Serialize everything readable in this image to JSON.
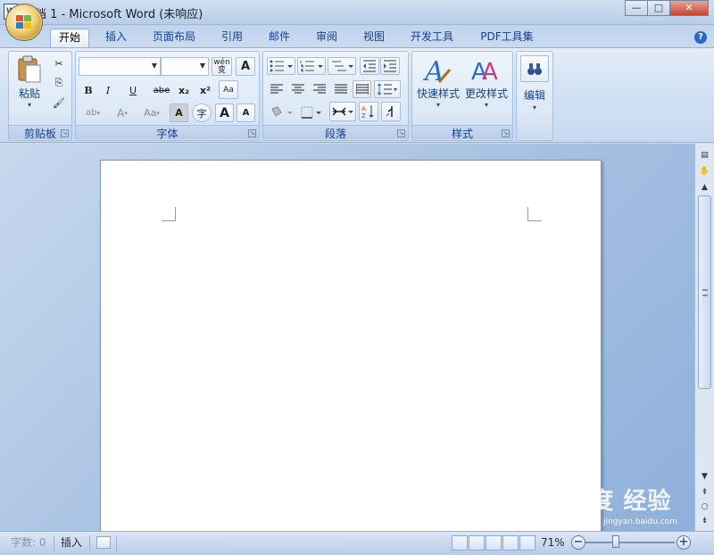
{
  "window": {
    "title": "文档 1 - Microsoft Word (未响应)",
    "app_icon_glyph": "W",
    "minimize_glyph": "—",
    "maximize_glyph": "□",
    "close_glyph": "✕"
  },
  "tabs": [
    {
      "label": "开始",
      "active": true
    },
    {
      "label": "插入",
      "active": false
    },
    {
      "label": "页面布局",
      "active": false
    },
    {
      "label": "引用",
      "active": false
    },
    {
      "label": "邮件",
      "active": false
    },
    {
      "label": "审阅",
      "active": false
    },
    {
      "label": "视图",
      "active": false
    },
    {
      "label": "开发工具",
      "active": false
    },
    {
      "label": "PDF工具集",
      "active": false
    }
  ],
  "help_glyph": "?",
  "ribbon": {
    "clipboard": {
      "label": "剪贴板",
      "paste_label": "粘贴",
      "cut_glyph": "✂",
      "copy_glyph": "⎘",
      "format_painter_glyph": "🖌"
    },
    "font": {
      "label": "字体",
      "font_name": "",
      "font_size": "",
      "wen_glyph": "wén 变",
      "char_border_glyph": "A",
      "bold": "B",
      "italic": "I",
      "underline": "U",
      "strike": "abe",
      "subscript": "x₂",
      "superscript": "x²",
      "clear_format": "Aa",
      "highlight": "ab",
      "font_color": "A",
      "change_case": "Aa",
      "char_shading": "A",
      "enclose": "字",
      "grow": "A",
      "shrink": "A"
    },
    "paragraph": {
      "label": "段落"
    },
    "styles": {
      "label": "样式",
      "quick_styles": "快速样式",
      "change_styles": "更改样式"
    },
    "editing": {
      "label": "编辑"
    }
  },
  "statusbar": {
    "word_count": "字数: 0",
    "insert_mode": "插入",
    "zoom": "71%",
    "zoom_out": "−",
    "zoom_in": "+"
  },
  "watermark": {
    "text": "Bai度 经验",
    "url": "jingyan.baidu.com"
  },
  "colors": {
    "accent": "#15428b",
    "ribbon_border": "#8db2e3",
    "close_button": "#c5442e"
  }
}
